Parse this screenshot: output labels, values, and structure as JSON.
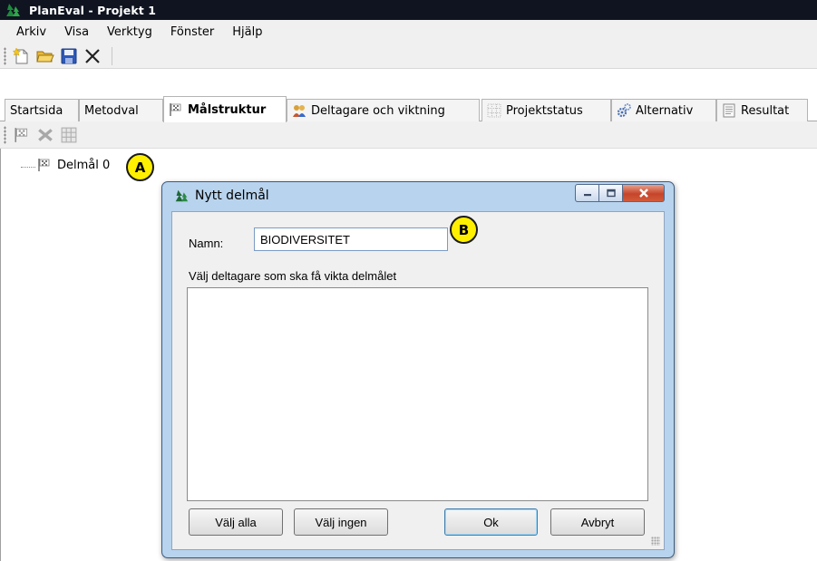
{
  "window": {
    "title": "PlanEval - Projekt 1"
  },
  "menu": {
    "items": [
      "Arkiv",
      "Visa",
      "Verktyg",
      "Fönster",
      "Hjälp"
    ]
  },
  "toolbar": {
    "buttons": [
      "new-file-icon",
      "open-folder-icon",
      "save-icon",
      "close-icon"
    ]
  },
  "tabs": [
    {
      "label": "Startsida",
      "icon": null,
      "active": false
    },
    {
      "label": "Metodval",
      "icon": null,
      "active": false
    },
    {
      "label": "Målstruktur",
      "icon": "flag-icon",
      "active": true
    },
    {
      "label": "Deltagare och viktning",
      "icon": "people-icon",
      "active": false
    },
    {
      "label": "Projektstatus",
      "icon": "grid-icon",
      "active": false
    },
    {
      "label": "Alternativ",
      "icon": "gears-icon",
      "active": false
    },
    {
      "label": "Resultat",
      "icon": "document-icon",
      "active": false
    }
  ],
  "subtoolbar": {
    "buttons": [
      "add-goal-icon",
      "delete-icon",
      "table-icon"
    ]
  },
  "tree": {
    "root": {
      "label": "Delmål 0"
    }
  },
  "callouts": {
    "a": "A",
    "b": "B"
  },
  "dialog": {
    "title": "Nytt delmål",
    "name_label": "Namn:",
    "name_value": "BIODIVERSITET",
    "list_label": "Välj deltagare som ska få vikta delmålet",
    "buttons": {
      "select_all": "Välj alla",
      "select_none": "Välj ingen",
      "ok": "Ok",
      "cancel": "Avbryt"
    }
  },
  "colors": {
    "title_bar": "#0f1420",
    "callout": "#ffef00",
    "dialog_frame": "#b8d3ed",
    "close_button": "#c6452a"
  }
}
